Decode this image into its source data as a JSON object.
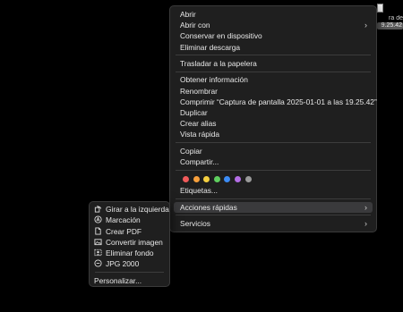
{
  "file": {
    "label_line1": "ra de",
    "label_line2": "9.25.42"
  },
  "context_menu": {
    "group1": [
      {
        "label": "Abrir"
      },
      {
        "label": "Abrir con",
        "submenu": true
      },
      {
        "label": "Conservar en dispositivo"
      },
      {
        "label": "Eliminar descarga"
      }
    ],
    "group2": [
      {
        "label": "Trasladar a la papelera"
      }
    ],
    "group3": [
      {
        "label": "Obtener información"
      },
      {
        "label": "Renombrar"
      },
      {
        "label": "Comprimir “Captura de pantalla 2025-01-01 a las 19.25.42”"
      },
      {
        "label": "Duplicar"
      },
      {
        "label": "Crear alias"
      },
      {
        "label": "Vista rápida"
      }
    ],
    "group4": [
      {
        "label": "Copiar"
      },
      {
        "label": "Compartir..."
      }
    ],
    "tag_colors": [
      {
        "name": "red",
        "hex": "#f15a5a"
      },
      {
        "name": "orange",
        "hex": "#f7a03c"
      },
      {
        "name": "yellow",
        "hex": "#f4cf40"
      },
      {
        "name": "green",
        "hex": "#5fcf5f"
      },
      {
        "name": "blue",
        "hex": "#3c8cf5"
      },
      {
        "name": "purple",
        "hex": "#b46ee6"
      },
      {
        "name": "gray",
        "hex": "#9a9a9a"
      }
    ],
    "tags_label": "Etiquetas...",
    "quick_actions": "Acciones rápidas",
    "services": "Servicios"
  },
  "quick_actions_menu": {
    "items": [
      {
        "label": "Girar a la izquierda",
        "icon": "rotate-left-icon"
      },
      {
        "label": "Marcación",
        "icon": "markup-icon"
      },
      {
        "label": "Crear PDF",
        "icon": "document-icon"
      },
      {
        "label": "Convertir imagen",
        "icon": "image-icon"
      },
      {
        "label": "Eliminar fondo",
        "icon": "remove-background-icon"
      },
      {
        "label": "JPG 2000",
        "icon": "jpg-minus-icon"
      }
    ],
    "customize": "Personalizar..."
  },
  "colors": {
    "menu_bg": "#1f1f1f",
    "highlight": "#3a3a3c"
  }
}
